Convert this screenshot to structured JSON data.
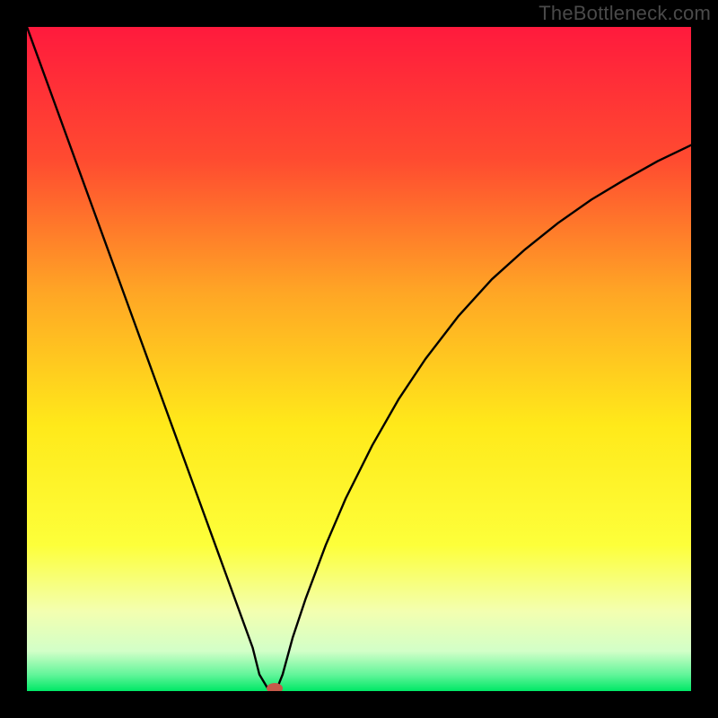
{
  "watermark": "TheBottleneck.com",
  "chart_data": {
    "type": "line",
    "title": "",
    "xlabel": "",
    "ylabel": "",
    "xlim": [
      0,
      100
    ],
    "ylim": [
      0,
      100
    ],
    "background_gradient": {
      "stops": [
        {
          "offset": 0.0,
          "color": "#ff1a3d"
        },
        {
          "offset": 0.2,
          "color": "#ff4b30"
        },
        {
          "offset": 0.4,
          "color": "#ffa625"
        },
        {
          "offset": 0.6,
          "color": "#ffe91a"
        },
        {
          "offset": 0.78,
          "color": "#fdff3a"
        },
        {
          "offset": 0.88,
          "color": "#f3ffb0"
        },
        {
          "offset": 0.94,
          "color": "#d2ffc8"
        },
        {
          "offset": 0.975,
          "color": "#63f59a"
        },
        {
          "offset": 1.0,
          "color": "#00e866"
        }
      ]
    },
    "series": [
      {
        "name": "bottleneck-curve",
        "color": "#000000",
        "x": [
          0,
          2,
          4,
          6,
          8,
          10,
          12,
          14,
          16,
          18,
          20,
          22,
          24,
          26,
          28,
          30,
          32,
          34,
          35,
          36.5,
          37.5,
          38.5,
          40,
          42,
          45,
          48,
          52,
          56,
          60,
          65,
          70,
          75,
          80,
          85,
          90,
          95,
          100
        ],
        "values": [
          100,
          94.5,
          89,
          83.5,
          78,
          72.5,
          67,
          61.5,
          56,
          50.5,
          45,
          39.5,
          34,
          28.5,
          23,
          17.5,
          12,
          6.5,
          2.5,
          0,
          0,
          2.5,
          8,
          14,
          22,
          29,
          37,
          44,
          50,
          56.5,
          62,
          66.5,
          70.5,
          74,
          77,
          79.8,
          82.2
        ]
      }
    ],
    "marker": {
      "name": "minimum-marker",
      "x": 37.3,
      "y": 0,
      "color": "#c55a4a",
      "rx": 9,
      "ry": 6
    }
  }
}
